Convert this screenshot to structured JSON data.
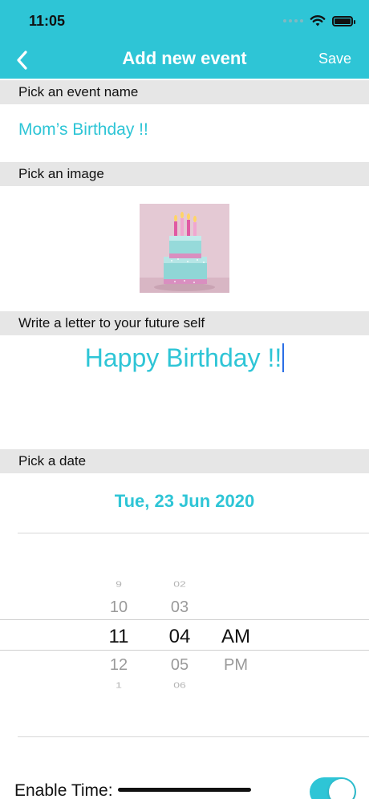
{
  "status_bar": {
    "time": "11:05",
    "icons": [
      "signal-dots-icon",
      "wifi-icon",
      "battery-icon"
    ]
  },
  "nav": {
    "back_icon": "chevron-left-icon",
    "title": "Add new event",
    "save_label": "Save"
  },
  "sections": {
    "name_header": "Pick an event name",
    "image_header": "Pick an image",
    "letter_header": "Write a letter to your future self",
    "date_header": "Pick a date"
  },
  "event_name": "Mom’s Birthday !!",
  "image": {
    "description_icon": "birthday-cake-image"
  },
  "letter": "Happy Birthday !!",
  "date_display": "Tue, 23 Jun 2020",
  "time_picker": {
    "hours": [
      "9",
      "10",
      "11",
      "12",
      "1"
    ],
    "minutes": [
      "02",
      "03",
      "04",
      "05",
      "06"
    ],
    "ampm": [
      "",
      "",
      "AM",
      "PM",
      ""
    ],
    "selected": {
      "hour": "11",
      "minute": "04",
      "period": "AM"
    }
  },
  "enable_time": {
    "label": "Enable Time:",
    "on": true
  },
  "colors": {
    "accent": "#2ec5d6",
    "section_bg": "#e6e6e6"
  }
}
